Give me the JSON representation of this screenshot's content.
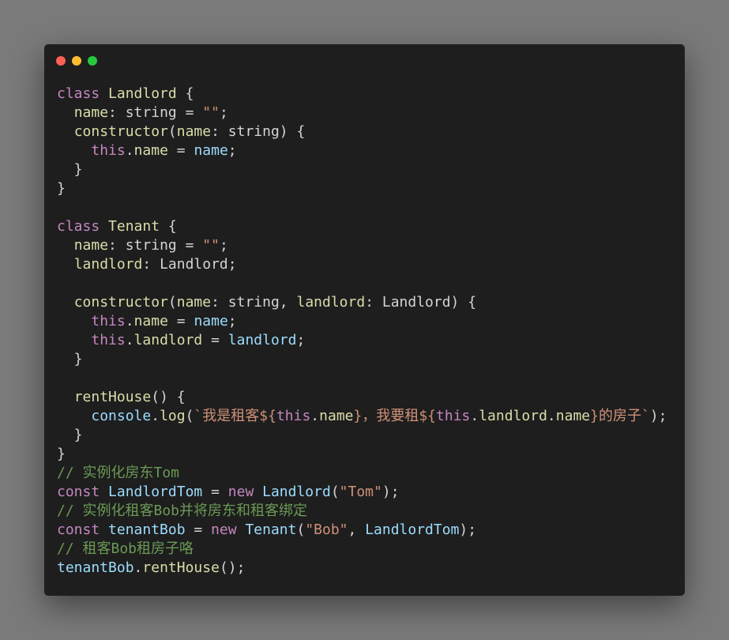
{
  "window": {
    "controls": [
      "close",
      "minimize",
      "maximize"
    ]
  },
  "code": {
    "lines": [
      [
        {
          "t": "class",
          "c": "kw"
        },
        {
          "t": " "
        },
        {
          "t": "Landlord",
          "c": "cls"
        },
        {
          "t": " {"
        }
      ],
      [
        {
          "t": "  "
        },
        {
          "t": "name",
          "c": "prop"
        },
        {
          "t": ": string = "
        },
        {
          "t": "\"\"",
          "c": "str"
        },
        {
          "t": ";"
        }
      ],
      [
        {
          "t": "  "
        },
        {
          "t": "constructor",
          "c": "fn"
        },
        {
          "t": "("
        },
        {
          "t": "name",
          "c": "prop"
        },
        {
          "t": ": string) {"
        }
      ],
      [
        {
          "t": "    "
        },
        {
          "t": "this",
          "c": "kw"
        },
        {
          "t": "."
        },
        {
          "t": "name",
          "c": "prop"
        },
        {
          "t": " = "
        },
        {
          "t": "name",
          "c": "var"
        },
        {
          "t": ";"
        }
      ],
      [
        {
          "t": "  }"
        }
      ],
      [
        {
          "t": "}"
        }
      ],
      [
        {
          "t": ""
        }
      ],
      [
        {
          "t": "class",
          "c": "kw"
        },
        {
          "t": " "
        },
        {
          "t": "Tenant",
          "c": "cls"
        },
        {
          "t": " {"
        }
      ],
      [
        {
          "t": "  "
        },
        {
          "t": "name",
          "c": "prop"
        },
        {
          "t": ": string = "
        },
        {
          "t": "\"\"",
          "c": "str"
        },
        {
          "t": ";"
        }
      ],
      [
        {
          "t": "  "
        },
        {
          "t": "landlord",
          "c": "prop"
        },
        {
          "t": ": Landlord;"
        }
      ],
      [
        {
          "t": ""
        }
      ],
      [
        {
          "t": "  "
        },
        {
          "t": "constructor",
          "c": "fn"
        },
        {
          "t": "("
        },
        {
          "t": "name",
          "c": "prop"
        },
        {
          "t": ": string, "
        },
        {
          "t": "landlord",
          "c": "prop"
        },
        {
          "t": ": Landlord) {"
        }
      ],
      [
        {
          "t": "    "
        },
        {
          "t": "this",
          "c": "kw"
        },
        {
          "t": "."
        },
        {
          "t": "name",
          "c": "prop"
        },
        {
          "t": " = "
        },
        {
          "t": "name",
          "c": "var"
        },
        {
          "t": ";"
        }
      ],
      [
        {
          "t": "    "
        },
        {
          "t": "this",
          "c": "kw"
        },
        {
          "t": "."
        },
        {
          "t": "landlord",
          "c": "prop"
        },
        {
          "t": " = "
        },
        {
          "t": "landlord",
          "c": "var"
        },
        {
          "t": ";"
        }
      ],
      [
        {
          "t": "  }"
        }
      ],
      [
        {
          "t": ""
        }
      ],
      [
        {
          "t": "  "
        },
        {
          "t": "rentHouse",
          "c": "fn"
        },
        {
          "t": "() {"
        }
      ],
      [
        {
          "t": "    "
        },
        {
          "t": "console",
          "c": "var"
        },
        {
          "t": "."
        },
        {
          "t": "log",
          "c": "fn"
        },
        {
          "t": "("
        },
        {
          "t": "`我是租客${",
          "c": "str"
        },
        {
          "t": "this",
          "c": "kw"
        },
        {
          "t": "."
        },
        {
          "t": "name",
          "c": "prop"
        },
        {
          "t": "}，我要租${",
          "c": "str"
        },
        {
          "t": "this",
          "c": "kw"
        },
        {
          "t": "."
        },
        {
          "t": "landlord",
          "c": "prop"
        },
        {
          "t": "."
        },
        {
          "t": "name",
          "c": "prop"
        },
        {
          "t": "}的房子`",
          "c": "str"
        },
        {
          "t": ");"
        }
      ],
      [
        {
          "t": "  }"
        }
      ],
      [
        {
          "t": "}"
        }
      ],
      [
        {
          "t": "// 实例化房东Tom",
          "c": "cmt"
        }
      ],
      [
        {
          "t": "const",
          "c": "kw"
        },
        {
          "t": " "
        },
        {
          "t": "LandlordTom",
          "c": "var"
        },
        {
          "t": " = "
        },
        {
          "t": "new",
          "c": "kw"
        },
        {
          "t": " "
        },
        {
          "t": "Landlord",
          "c": "var"
        },
        {
          "t": "("
        },
        {
          "t": "\"Tom\"",
          "c": "str"
        },
        {
          "t": ");"
        }
      ],
      [
        {
          "t": "// 实例化租客Bob并将房东和租客绑定",
          "c": "cmt"
        }
      ],
      [
        {
          "t": "const",
          "c": "kw"
        },
        {
          "t": " "
        },
        {
          "t": "tenantBob",
          "c": "var"
        },
        {
          "t": " = "
        },
        {
          "t": "new",
          "c": "kw"
        },
        {
          "t": " "
        },
        {
          "t": "Tenant",
          "c": "var"
        },
        {
          "t": "("
        },
        {
          "t": "\"Bob\"",
          "c": "str"
        },
        {
          "t": ", "
        },
        {
          "t": "LandlordTom",
          "c": "var"
        },
        {
          "t": ");"
        }
      ],
      [
        {
          "t": "// 租客Bob租房子咯",
          "c": "cmt"
        }
      ],
      [
        {
          "t": "tenantBob",
          "c": "var"
        },
        {
          "t": "."
        },
        {
          "t": "rentHouse",
          "c": "fn"
        },
        {
          "t": "();"
        }
      ]
    ]
  },
  "colors": {
    "background": "#7a7a7a",
    "editor_background": "#1e1e1e",
    "close": "#ff5f56",
    "minimize": "#ffbd2e",
    "maximize": "#27c93f",
    "keyword": "#c586c0",
    "class_name": "#dcdcaa",
    "variable": "#9cdcfe",
    "string": "#ce9178",
    "comment": "#6a9955",
    "text": "#d4d4d4"
  }
}
